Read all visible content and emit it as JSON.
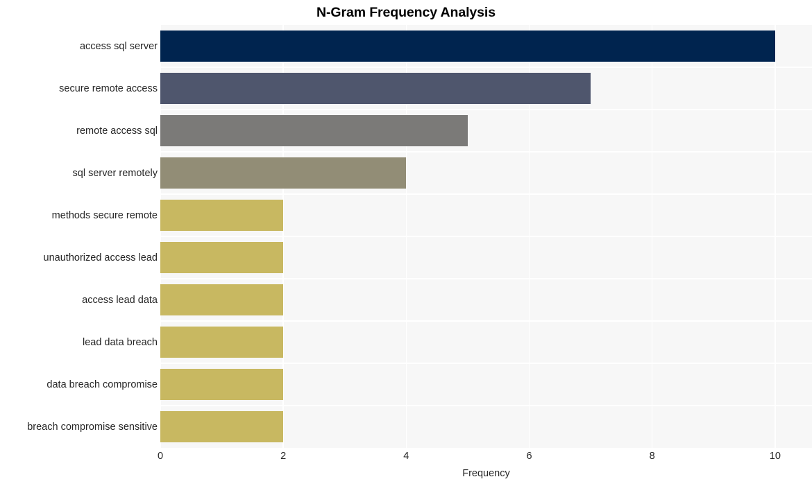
{
  "chart_data": {
    "type": "bar",
    "orientation": "horizontal",
    "title": "N-Gram Frequency Analysis",
    "xlabel": "Frequency",
    "ylabel": "",
    "categories": [
      "access sql server",
      "secure remote access",
      "remote access sql",
      "sql server remotely",
      "methods secure remote",
      "unauthorized access lead",
      "access lead data",
      "lead data breach",
      "data breach compromise",
      "breach compromise sensitive"
    ],
    "values": [
      10,
      7,
      5,
      4,
      2,
      2,
      2,
      2,
      2,
      2
    ],
    "bar_colors": [
      "#00244f",
      "#4f566d",
      "#7b7a78",
      "#928d76",
      "#c8b861",
      "#c8b861",
      "#c8b861",
      "#c8b861",
      "#c8b861",
      "#c8b861"
    ],
    "xlim": [
      0,
      10.6
    ],
    "xticks": [
      0,
      2,
      4,
      6,
      8,
      10
    ],
    "xtick_labels": [
      "0",
      "2",
      "4",
      "6",
      "8",
      "10"
    ],
    "grid": true,
    "grid_color": "#ffffff",
    "legend": null,
    "plot_background": "#f7f7f7",
    "figure_background": "#ffffff",
    "text_color": "#262626",
    "title_color": "#000000"
  }
}
